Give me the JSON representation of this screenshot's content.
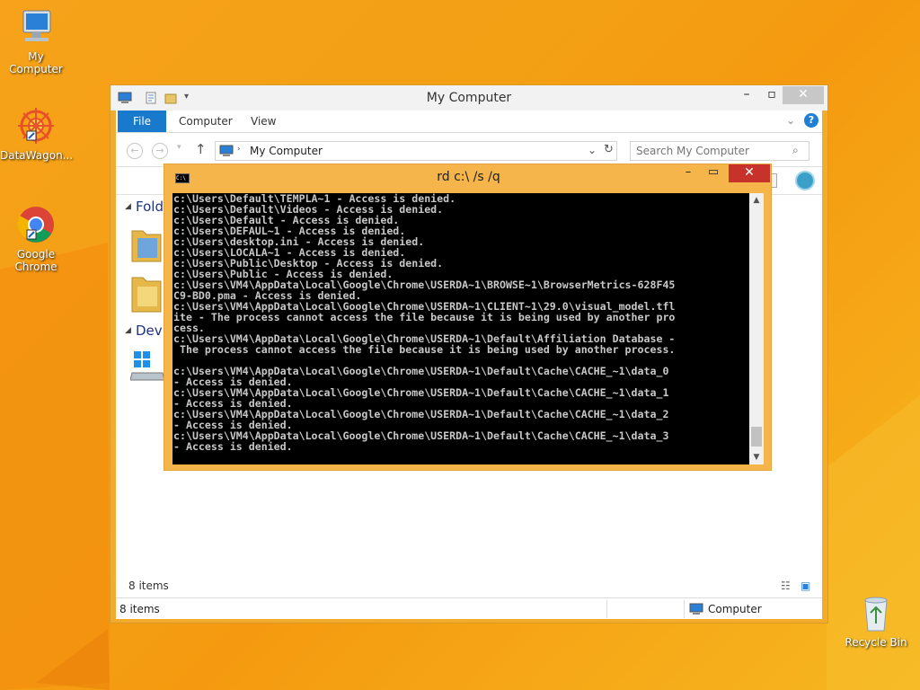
{
  "desktop": {
    "icons": [
      {
        "label": "My Computer",
        "icon": "computer-icon"
      },
      {
        "label": "DataWagon...",
        "icon": "datawagon-icon"
      },
      {
        "label": "Google Chrome",
        "icon": "chrome-icon"
      },
      {
        "label": "Recycle Bin",
        "icon": "recycle-bin-icon"
      }
    ]
  },
  "explorer": {
    "title": "My Computer",
    "ribbon_tabs": [
      "File",
      "Computer",
      "View"
    ],
    "address": "My Computer",
    "search_placeholder": "Search My Computer",
    "sections": [
      "Folde",
      "Devi"
    ],
    "item_count": "8 items",
    "status_items": "8 items",
    "status_location": "Computer"
  },
  "cmd": {
    "title": "rd  c:\\ /s /q",
    "output": "c:\\Users\\Default\\TEMPLA~1 - Access is denied.\nc:\\Users\\Default\\Videos - Access is denied.\nc:\\Users\\Default - Access is denied.\nc:\\Users\\DEFAUL~1 - Access is denied.\nc:\\Users\\desktop.ini - Access is denied.\nc:\\Users\\LOCALA~1 - Access is denied.\nc:\\Users\\Public\\Desktop - Access is denied.\nc:\\Users\\Public - Access is denied.\nc:\\Users\\VM4\\AppData\\Local\\Google\\Chrome\\USERDA~1\\BROWSE~1\\BrowserMetrics-628F45\nC9-BD0.pma - Access is denied.\nc:\\Users\\VM4\\AppData\\Local\\Google\\Chrome\\USERDA~1\\CLIENT~1\\29.0\\visual_model.tfl\nite - The process cannot access the file because it is being used by another pro\ncess.\nc:\\Users\\VM4\\AppData\\Local\\Google\\Chrome\\USERDA~1\\Default\\Affiliation Database -\n The process cannot access the file because it is being used by another process.\n\nc:\\Users\\VM4\\AppData\\Local\\Google\\Chrome\\USERDA~1\\Default\\Cache\\CACHE_~1\\data_0\n- Access is denied.\nc:\\Users\\VM4\\AppData\\Local\\Google\\Chrome\\USERDA~1\\Default\\Cache\\CACHE_~1\\data_1\n- Access is denied.\nc:\\Users\\VM4\\AppData\\Local\\Google\\Chrome\\USERDA~1\\Default\\Cache\\CACHE_~1\\data_2\n- Access is denied.\nc:\\Users\\VM4\\AppData\\Local\\Google\\Chrome\\USERDA~1\\Default\\Cache\\CACHE_~1\\data_3\n- Access is denied."
  },
  "colors": {
    "desktop_bg": "#f5a015",
    "explorer_frame": "#f2ab2c",
    "file_tab": "#1979ca",
    "cmd_close": "#c7332b"
  }
}
